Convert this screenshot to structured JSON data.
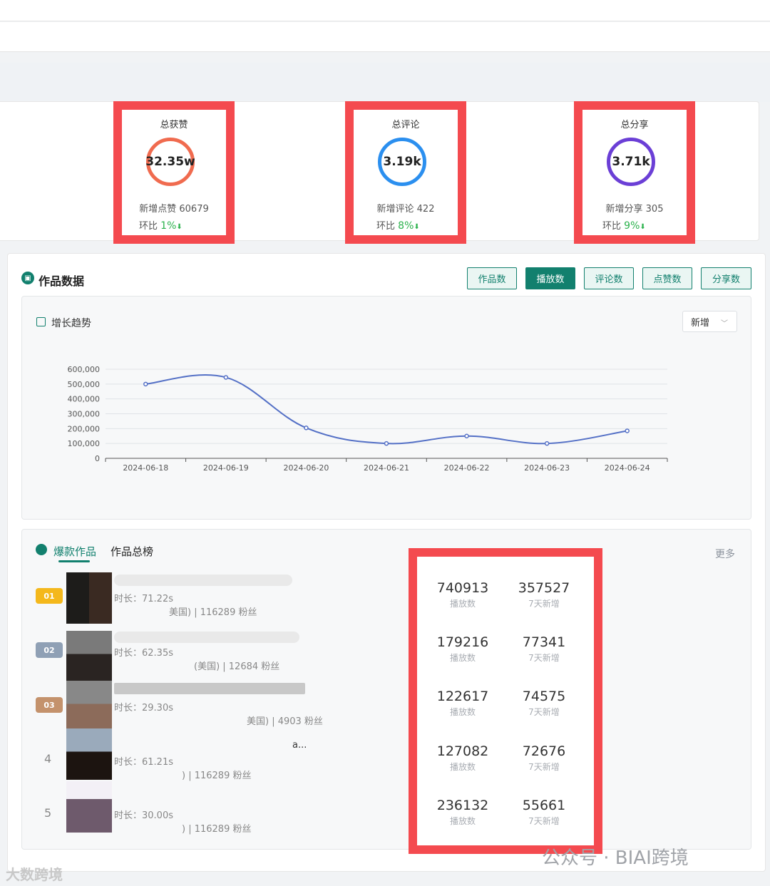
{
  "stats": [
    {
      "title": "总获赞",
      "value": "32.35w",
      "new_label": "新增点赞 60679",
      "ratio_label": "环比",
      "ratio": "1%",
      "ring_color": "#f06b4f"
    },
    {
      "title": "总评论",
      "value": "3.19k",
      "new_label": "新增评论 422",
      "ratio_label": "环比",
      "ratio": "8%",
      "ring_color": "#2b8fef"
    },
    {
      "title": "总分享",
      "value": "3.71k",
      "new_label": "新增分享 305",
      "ratio_label": "环比",
      "ratio": "9%",
      "ring_color": "#6b3fd6"
    }
  ],
  "works": {
    "title": "作品数据",
    "tabs": [
      "作品数",
      "播放数",
      "评论数",
      "点赞数",
      "分享数"
    ],
    "active_tab": "播放数"
  },
  "trend": {
    "title": "增长趋势",
    "dropdown": "新增"
  },
  "chart_data": {
    "type": "line",
    "x": [
      "2024-06-18",
      "2024-06-19",
      "2024-06-20",
      "2024-06-21",
      "2024-06-22",
      "2024-06-23",
      "2024-06-24"
    ],
    "values": [
      500000,
      545000,
      205000,
      100000,
      150000,
      100000,
      185000
    ],
    "yticks": [
      "0",
      "100,000",
      "200,000",
      "300,000",
      "400,000",
      "500,000",
      "600,000"
    ],
    "ylim": [
      0,
      600000
    ],
    "line_color": "#5470c6",
    "grid": true
  },
  "hot": {
    "tab_active": "爆款作品",
    "tab_other": "作品总榜",
    "more": "更多",
    "rows": [
      {
        "rank": "01",
        "duration": "时长：71.22s",
        "meta": "美国) | 116289 粉丝",
        "play": "740913",
        "play_label": "播放数",
        "new7": "357527",
        "new7_label": "7天新增"
      },
      {
        "rank": "02",
        "duration": "时长：62.35s",
        "meta": "(美国) | 12684 粉丝",
        "play": "179216",
        "play_label": "播放数",
        "new7": "77341",
        "new7_label": "7天新增"
      },
      {
        "rank": "03",
        "duration": "时长：29.30s",
        "meta": "美国) | 4903 粉丝",
        "play": "122617",
        "play_label": "播放数",
        "new7": "74575",
        "new7_label": "7天新增"
      },
      {
        "rank": "4",
        "duration": "时长：61.21s",
        "meta": ") | 116289 粉丝",
        "extra": "a...",
        "play": "127082",
        "play_label": "播放数",
        "new7": "72676",
        "new7_label": "7天新增"
      },
      {
        "rank": "5",
        "duration": "时长：30.00s",
        "meta": ") | 116289 粉丝",
        "play": "236132",
        "play_label": "播放数",
        "new7": "55661",
        "new7_label": "7天新增"
      }
    ]
  },
  "watermark": {
    "left": "大数跨境",
    "right": "公众号 · BIAI跨境"
  }
}
